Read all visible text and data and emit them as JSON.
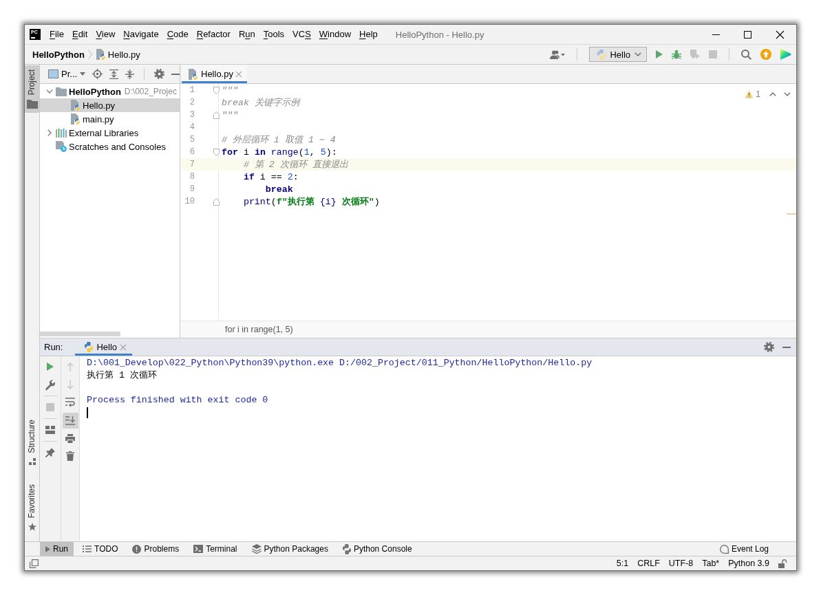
{
  "title_bar": {
    "logo": "PC",
    "menu": [
      {
        "key": "F",
        "rest": "ile"
      },
      {
        "key": "E",
        "rest": "dit"
      },
      {
        "key": "V",
        "rest": "iew"
      },
      {
        "key": "N",
        "rest": "avigate"
      },
      {
        "key": "C",
        "rest": "ode"
      },
      {
        "key": "R",
        "rest": "efactor"
      },
      {
        "lead": "R",
        "key": "u",
        "rest": "n"
      },
      {
        "key": "T",
        "rest": "ools"
      },
      {
        "lead": "VC",
        "key": "S"
      },
      {
        "key": "W",
        "rest": "indow"
      },
      {
        "key": "H",
        "rest": "elp"
      }
    ],
    "title": "HelloPython - Hello.py"
  },
  "navigation_bar": {
    "breadcrumbs": [
      {
        "kind": "project",
        "label": "HelloPython"
      },
      {
        "kind": "file",
        "label": "Hello.py"
      }
    ],
    "run_config": "Hello",
    "actions": [
      {
        "disabled": false
      },
      {
        "disabled": false
      },
      {
        "disabled": true
      },
      {
        "disabled": true
      }
    ]
  },
  "left_stripe": {
    "top": [
      {
        "label": "Project",
        "selected": true
      }
    ],
    "bottom": [
      {
        "label": "Structure",
        "selected": false
      },
      {
        "label": "Favorites",
        "selected": false
      }
    ]
  },
  "project_panel": {
    "view": "Pr...",
    "tree": [
      {
        "kind": "project",
        "label": "HelloPython",
        "path": "D:\\002_Projec",
        "expanded": true,
        "selected": false,
        "children": [
          {
            "kind": "python_file",
            "label": "Hello.py",
            "selected": true
          },
          {
            "kind": "python_file",
            "label": "main.py",
            "selected": false
          }
        ]
      },
      {
        "kind": "libraries",
        "label": "External Libraries",
        "expanded": false,
        "selected": false
      },
      {
        "kind": "scratches",
        "label": "Scratches and Consoles",
        "selected": false
      }
    ]
  },
  "editor": {
    "tabs": [
      {
        "label": "Hello.py",
        "selected": true
      }
    ],
    "warnings": "1",
    "lines": [
      {
        "number": "1",
        "fold_start": true,
        "fold_end": false,
        "current": false,
        "tokens": [
          {
            "kind": "docstring",
            "text": "\"\"\""
          }
        ]
      },
      {
        "number": "2",
        "fold_start": false,
        "fold_end": false,
        "current": false,
        "tokens": [
          {
            "kind": "docstring",
            "text": "break 关键字示例"
          }
        ]
      },
      {
        "number": "3",
        "fold_start": false,
        "fold_end": true,
        "current": false,
        "tokens": [
          {
            "kind": "docstring",
            "text": "\"\"\""
          }
        ]
      },
      {
        "number": "4",
        "fold_start": false,
        "fold_end": false,
        "current": false
      },
      {
        "number": "5",
        "fold_start": false,
        "fold_end": false,
        "current": false,
        "tokens": [
          {
            "kind": "comment",
            "text": "# 外层循环 i 取值 1 ~ 4"
          }
        ]
      },
      {
        "number": "6",
        "fold_start": true,
        "fold_end": false,
        "current": false,
        "tokens": [
          {
            "kind": "keyword",
            "text": "for"
          },
          {
            "kind": "plain",
            "text": " i "
          },
          {
            "kind": "keyword",
            "text": "in"
          },
          {
            "kind": "builtin",
            "text": " range"
          },
          {
            "kind": "plain",
            "text": "("
          },
          {
            "kind": "number",
            "text": "1"
          },
          {
            "kind": "plain",
            "text": ", "
          },
          {
            "kind": "number",
            "text": "5"
          },
          {
            "kind": "plain",
            "text": "):"
          }
        ],
        "children": [
          {
            "number": "7",
            "fold_start": false,
            "fold_end": false,
            "current": true,
            "tokens": [
              {
                "kind": "comment",
                "text": "# 第 2 次循环 直接退出"
              }
            ]
          },
          {
            "number": "8",
            "fold_start": false,
            "fold_end": false,
            "current": false,
            "tokens": [
              {
                "kind": "keyword",
                "text": "if"
              },
              {
                "kind": "plain",
                "text": " i == "
              },
              {
                "kind": "number",
                "text": "2"
              },
              {
                "kind": "plain",
                "text": ":"
              }
            ],
            "children": [
              {
                "number": "9",
                "fold_start": false,
                "fold_end": false,
                "current": false,
                "tokens": [
                  {
                    "kind": "keyword",
                    "text": "break"
                  }
                ]
              }
            ]
          },
          {
            "number": "10",
            "fold_start": false,
            "fold_end": true,
            "current": false,
            "tokens": [
              {
                "kind": "builtin",
                "text": "print"
              },
              {
                "kind": "plain",
                "text": "("
              },
              {
                "kind": "string",
                "text": "f\"执行第 "
              },
              {
                "kind": "brace",
                "text": "{i}"
              },
              {
                "kind": "string",
                "text": " 次循环\""
              },
              {
                "kind": "plain",
                "text": ")"
              }
            ]
          }
        ]
      }
    ],
    "breadcrumb": "for i in range(1, 5)"
  },
  "run_panel": {
    "label": "Run:",
    "tabs": [
      {
        "label": "Hello",
        "selected": true
      }
    ],
    "left_actions": [
      {
        "disabled": false
      },
      {
        "disabled": false
      },
      {
        "disabled": true
      },
      {
        "disabled": false
      },
      {
        "disabled": false
      }
    ],
    "right_actions": [
      {
        "disabled": true,
        "selected": false
      },
      {
        "disabled": true,
        "selected": false
      },
      {
        "disabled": false,
        "selected": false
      },
      {
        "disabled": false,
        "selected": true
      },
      {
        "disabled": false,
        "selected": false
      },
      {
        "disabled": false,
        "selected": false
      }
    ],
    "console": [
      {
        "kind": "system",
        "text": "D:\\001_Develop\\022_Python\\Python39\\python.exe D:/002_Project/011_Python/HelloPython/Hello.py"
      },
      {
        "kind": "output",
        "text": "执行第 1 次循环"
      },
      {
        "kind": "blank"
      },
      {
        "kind": "system",
        "text": "Process finished with exit code 0"
      },
      {
        "kind": "cursor"
      }
    ]
  },
  "bottom_bar": {
    "tools": [
      {
        "label": "Run",
        "selected": true
      },
      {
        "label": "TODO",
        "selected": false
      },
      {
        "label": "Problems",
        "selected": false
      },
      {
        "label": "Terminal",
        "selected": false
      },
      {
        "label": "Python Packages",
        "selected": false
      },
      {
        "label": "Python Console",
        "selected": false
      }
    ],
    "event_log": "Event Log"
  },
  "status_bar": {
    "items": [
      "5:1",
      "CRLF",
      "UTF-8",
      "Tab*",
      "Python 3.9"
    ]
  }
}
